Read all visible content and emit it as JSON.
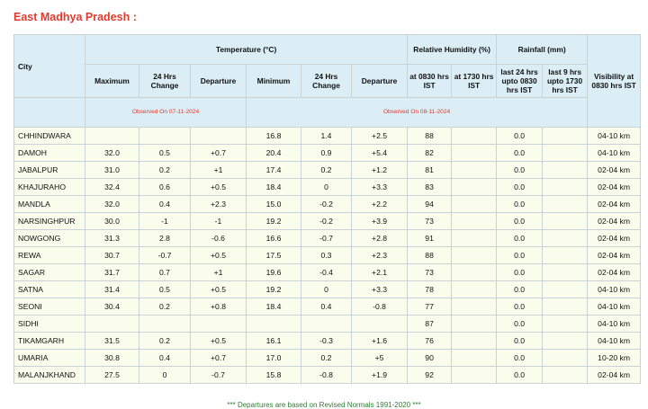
{
  "section_title": "East Madhya Pradesh :",
  "headers": {
    "city": "City",
    "temperature": "Temperature (°C)",
    "humidity": "Relative Humidity (%)",
    "rainfall": "Rainfall (mm)",
    "visibility": "Visibility at 0830 hrs IST",
    "maximum": "Maximum",
    "change24_max": "24 Hrs Change",
    "departure_max": "Departure",
    "minimum": "Minimum",
    "change24_min": "24 Hrs Change",
    "departure_min": "Departure",
    "rh_0830": "at 0830 hrs IST",
    "rh_1730": "at 1730 hrs IST",
    "rain_24": "last 24 hrs upto 0830 hrs IST",
    "rain_9": "last 9 hrs upto 1730 hrs IST",
    "observed_max": "Observed On 07-11-2024",
    "observed_min": "Observed On 08-11-2024"
  },
  "rows": [
    {
      "city": "CHHINDWARA",
      "max": "",
      "chg_max": "",
      "dep_max": "",
      "min": "16.8",
      "chg_min": "1.4",
      "dep_min": "+2.5",
      "rh0830": "88",
      "rh1730": "",
      "rain24": "0.0",
      "rain9": "",
      "vis": "04-10 km"
    },
    {
      "city": "DAMOH",
      "max": "32.0",
      "chg_max": "0.5",
      "dep_max": "+0.7",
      "min": "20.4",
      "chg_min": "0.9",
      "dep_min": "+5.4",
      "rh0830": "82",
      "rh1730": "",
      "rain24": "0.0",
      "rain9": "",
      "vis": "04-10 km"
    },
    {
      "city": "JABALPUR",
      "max": "31.0",
      "chg_max": "0.2",
      "dep_max": "+1",
      "min": "17.4",
      "chg_min": "0.2",
      "dep_min": "+1.2",
      "rh0830": "81",
      "rh1730": "",
      "rain24": "0.0",
      "rain9": "",
      "vis": "02-04 km"
    },
    {
      "city": "KHAJURAHO",
      "max": "32.4",
      "chg_max": "0.6",
      "dep_max": "+0.5",
      "min": "18.4",
      "chg_min": "0",
      "dep_min": "+3.3",
      "rh0830": "83",
      "rh1730": "",
      "rain24": "0.0",
      "rain9": "",
      "vis": "02-04 km"
    },
    {
      "city": "MANDLA",
      "max": "32.0",
      "chg_max": "0.4",
      "dep_max": "+2.3",
      "min": "15.0",
      "chg_min": "-0.2",
      "dep_min": "+2.2",
      "rh0830": "94",
      "rh1730": "",
      "rain24": "0.0",
      "rain9": "",
      "vis": "02-04 km"
    },
    {
      "city": "NARSINGHPUR",
      "max": "30.0",
      "chg_max": "-1",
      "dep_max": "-1",
      "min": "19.2",
      "chg_min": "-0.2",
      "dep_min": "+3.9",
      "rh0830": "73",
      "rh1730": "",
      "rain24": "0.0",
      "rain9": "",
      "vis": "02-04 km"
    },
    {
      "city": "NOWGONG",
      "max": "31.3",
      "chg_max": "2.8",
      "dep_max": "-0.6",
      "min": "16.6",
      "chg_min": "-0.7",
      "dep_min": "+2.8",
      "rh0830": "91",
      "rh1730": "",
      "rain24": "0.0",
      "rain9": "",
      "vis": "02-04 km"
    },
    {
      "city": "REWA",
      "max": "30.7",
      "chg_max": "-0.7",
      "dep_max": "+0.5",
      "min": "17.5",
      "chg_min": "0.3",
      "dep_min": "+2.3",
      "rh0830": "88",
      "rh1730": "",
      "rain24": "0.0",
      "rain9": "",
      "vis": "02-04 km"
    },
    {
      "city": "SAGAR",
      "max": "31.7",
      "chg_max": "0.7",
      "dep_max": "+1",
      "min": "19.6",
      "chg_min": "-0.4",
      "dep_min": "+2.1",
      "rh0830": "73",
      "rh1730": "",
      "rain24": "0.0",
      "rain9": "",
      "vis": "02-04 km"
    },
    {
      "city": "SATNA",
      "max": "31.4",
      "chg_max": "0.5",
      "dep_max": "+0.5",
      "min": "19.2",
      "chg_min": "0",
      "dep_min": "+3.3",
      "rh0830": "78",
      "rh1730": "",
      "rain24": "0.0",
      "rain9": "",
      "vis": "04-10 km"
    },
    {
      "city": "SEONI",
      "max": "30.4",
      "chg_max": "0.2",
      "dep_max": "+0.8",
      "min": "18.4",
      "chg_min": "0.4",
      "dep_min": "-0.8",
      "rh0830": "77",
      "rh1730": "",
      "rain24": "0.0",
      "rain9": "",
      "vis": "04-10 km"
    },
    {
      "city": "SIDHI",
      "max": "",
      "chg_max": "",
      "dep_max": "",
      "min": "",
      "chg_min": "",
      "dep_min": "",
      "rh0830": "87",
      "rh1730": "",
      "rain24": "0.0",
      "rain9": "",
      "vis": "04-10 km"
    },
    {
      "city": "TIKAMGARH",
      "max": "31.5",
      "chg_max": "0.2",
      "dep_max": "+0.5",
      "min": "16.1",
      "chg_min": "-0.3",
      "dep_min": "+1.6",
      "rh0830": "76",
      "rh1730": "",
      "rain24": "0.0",
      "rain9": "",
      "vis": "04-10 km"
    },
    {
      "city": "UMARIA",
      "max": "30.8",
      "chg_max": "0.4",
      "dep_max": "+0.7",
      "min": "17.0",
      "chg_min": "0.2",
      "dep_min": "+5",
      "rh0830": "90",
      "rh1730": "",
      "rain24": "0.0",
      "rain9": "",
      "vis": "10-20 km"
    },
    {
      "city": "MALANJKHAND",
      "max": "27.5",
      "chg_max": "0",
      "dep_max": "-0.7",
      "min": "15.8",
      "chg_min": "-0.8",
      "dep_min": "+1.9",
      "rh0830": "92",
      "rh1730": "",
      "rain24": "0.0",
      "rain9": "",
      "vis": "02-04 km"
    }
  ],
  "footnote": "*** Departures are based on Revised Normals 1991-2020 ***",
  "colors": {
    "title_red": "#e23b2e",
    "header_bg": "#dbeef5",
    "row_bg": "#fbfdec",
    "border": "#c9d3d6",
    "footnote_green": "#2e7d32"
  }
}
